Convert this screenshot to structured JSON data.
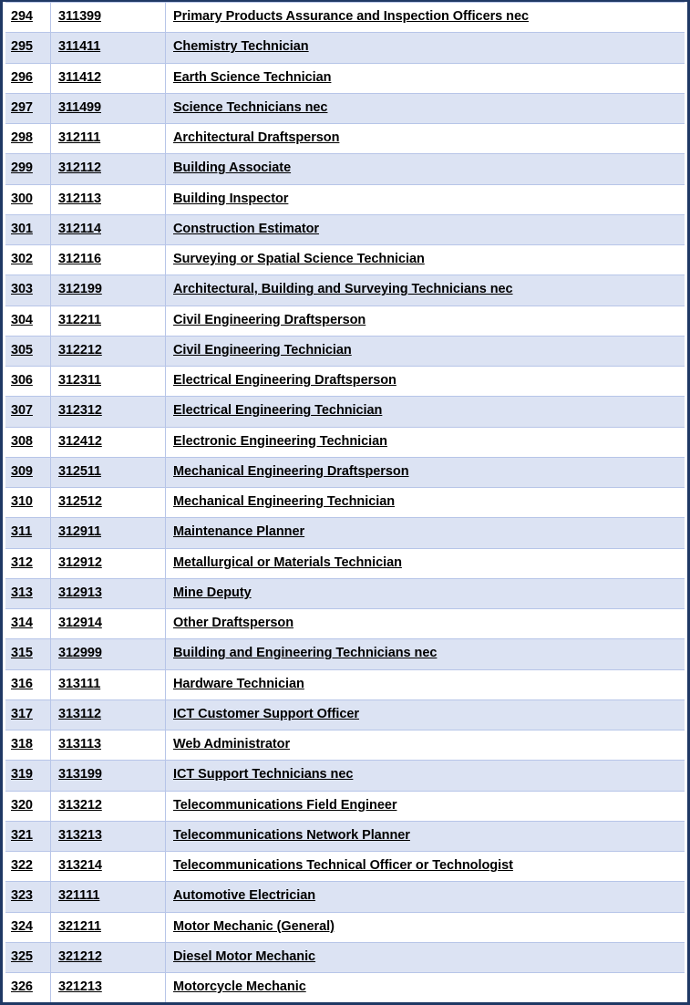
{
  "document": {
    "type": "occupation-code-table",
    "columns": [
      "index",
      "code",
      "occupation_title"
    ],
    "frame_color": "#1f3864",
    "row_shade_color": "#dce3f3",
    "grid_line_color": "#b7c5e8",
    "text_color": "#000000"
  },
  "rows": [
    {
      "index": "294",
      "code": "311399",
      "title": "Primary Products Assurance and Inspection Officers nec"
    },
    {
      "index": "295",
      "code": "311411",
      "title": "Chemistry Technician"
    },
    {
      "index": "296",
      "code": "311412",
      "title": "Earth Science Technician"
    },
    {
      "index": "297",
      "code": "311499",
      "title": "Science Technicians nec"
    },
    {
      "index": "298",
      "code": "312111",
      "title": "Architectural Draftsperson"
    },
    {
      "index": "299",
      "code": "312112",
      "title": "Building Associate"
    },
    {
      "index": "300",
      "code": "312113",
      "title": "Building Inspector"
    },
    {
      "index": "301",
      "code": "312114",
      "title": "Construction Estimator"
    },
    {
      "index": "302",
      "code": "312116",
      "title": "Surveying or Spatial Science Technician"
    },
    {
      "index": "303",
      "code": "312199",
      "title": "Architectural, Building and Surveying Technicians nec"
    },
    {
      "index": "304",
      "code": "312211",
      "title": "Civil Engineering Draftsperson"
    },
    {
      "index": "305",
      "code": "312212",
      "title": "Civil Engineering Technician"
    },
    {
      "index": "306",
      "code": "312311",
      "title": "Electrical Engineering Draftsperson"
    },
    {
      "index": "307",
      "code": "312312",
      "title": "Electrical Engineering Technician"
    },
    {
      "index": "308",
      "code": "312412",
      "title": "Electronic Engineering Technician"
    },
    {
      "index": "309",
      "code": "312511",
      "title": "Mechanical Engineering Draftsperson"
    },
    {
      "index": "310",
      "code": "312512",
      "title": "Mechanical Engineering Technician"
    },
    {
      "index": "311",
      "code": "312911",
      "title": "Maintenance Planner"
    },
    {
      "index": "312",
      "code": "312912",
      "title": "Metallurgical or Materials Technician"
    },
    {
      "index": "313",
      "code": "312913",
      "title": "Mine Deputy"
    },
    {
      "index": "314",
      "code": "312914",
      "title": "Other Draftsperson"
    },
    {
      "index": "315",
      "code": "312999",
      "title": "Building and Engineering Technicians nec"
    },
    {
      "index": "316",
      "code": "313111",
      "title": "Hardware Technician"
    },
    {
      "index": "317",
      "code": "313112",
      "title": "ICT Customer Support Officer"
    },
    {
      "index": "318",
      "code": "313113",
      "title": "Web Administrator"
    },
    {
      "index": "319",
      "code": "313199",
      "title": "ICT Support Technicians nec"
    },
    {
      "index": "320",
      "code": "313212",
      "title": "Telecommunications Field Engineer"
    },
    {
      "index": "321",
      "code": "313213",
      "title": "Telecommunications Network Planner"
    },
    {
      "index": "322",
      "code": "313214",
      "title": "Telecommunications Technical Officer or Technologist"
    },
    {
      "index": "323",
      "code": "321111",
      "title": "Automotive Electrician"
    },
    {
      "index": "324",
      "code": "321211",
      "title": "Motor Mechanic (General)"
    },
    {
      "index": "325",
      "code": "321212",
      "title": "Diesel Motor Mechanic"
    },
    {
      "index": "326",
      "code": "321213",
      "title": "Motorcycle Mechanic"
    }
  ]
}
